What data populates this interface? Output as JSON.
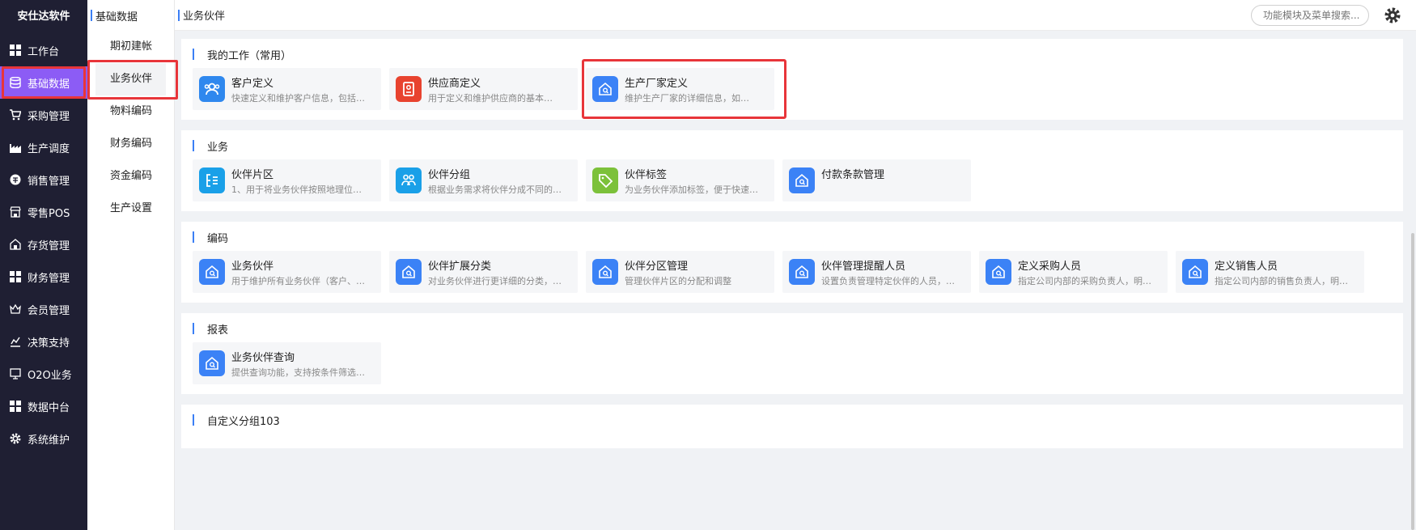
{
  "app": {
    "title": "安仕达软件"
  },
  "nav": {
    "items": [
      {
        "label": "工作台",
        "icon": "grid-icon"
      },
      {
        "label": "基础数据",
        "icon": "database-icon"
      },
      {
        "label": "采购管理",
        "icon": "cart-icon"
      },
      {
        "label": "生产调度",
        "icon": "factory-icon"
      },
      {
        "label": "销售管理",
        "icon": "sales-icon"
      },
      {
        "label": "零售POS",
        "icon": "store-icon"
      },
      {
        "label": "存货管理",
        "icon": "warehouse-icon"
      },
      {
        "label": "财务管理",
        "icon": "grid-icon"
      },
      {
        "label": "会员管理",
        "icon": "crown-icon"
      },
      {
        "label": "决策支持",
        "icon": "chart-icon"
      },
      {
        "label": "O2O业务",
        "icon": "monitor-icon"
      },
      {
        "label": "数据中台",
        "icon": "grid-icon"
      },
      {
        "label": "系统维护",
        "icon": "gear-icon"
      }
    ]
  },
  "subnav": {
    "title": "基础数据",
    "items": [
      "期初建帐",
      "业务伙伴",
      "物料编码",
      "财务编码",
      "资金编码",
      "生产设置"
    ]
  },
  "header": {
    "title": "业务伙伴",
    "search_placeholder": "功能模块及菜单搜索..."
  },
  "sections": [
    {
      "title": "我的工作（常用）",
      "cards": [
        {
          "name": "客户定义",
          "desc": "快速定义和维护客户信息，包括…",
          "icon": "customer-icon",
          "color": "#2f88ee"
        },
        {
          "name": "供应商定义",
          "desc": "用于定义和维护供应商的基本…",
          "icon": "supplier-icon",
          "color": "#e8432f"
        },
        {
          "name": "生产厂家定义",
          "desc": "维护生产厂家的详细信息，如…",
          "icon": "home-search-icon",
          "color": "#3b82f6"
        }
      ]
    },
    {
      "title": "业务",
      "cards": [
        {
          "name": "伙伴片区",
          "desc": "1、用于将业务伙伴按照地理位…",
          "icon": "region-icon",
          "color": "#1aa0e8"
        },
        {
          "name": "伙伴分组",
          "desc": "根据业务需求将伙伴分成不同的…",
          "icon": "group-icon",
          "color": "#1aa0e8"
        },
        {
          "name": "伙伴标签",
          "desc": "为业务伙伴添加标签，便于快速…",
          "icon": "tag-icon",
          "color": "#7cc13a"
        },
        {
          "name": "付款条款管理",
          "desc": "",
          "icon": "home-search-icon",
          "color": "#3b82f6"
        }
      ]
    },
    {
      "title": "编码",
      "cards": [
        {
          "name": "业务伙伴",
          "desc": "用于维护所有业务伙伴（客户、…",
          "icon": "home-search-icon",
          "color": "#3b82f6"
        },
        {
          "name": "伙伴扩展分类",
          "desc": "对业务伙伴进行更详细的分类，…",
          "icon": "home-search-icon",
          "color": "#3b82f6"
        },
        {
          "name": "伙伴分区管理",
          "desc": "管理伙伴片区的分配和调整",
          "icon": "home-search-icon",
          "color": "#3b82f6"
        },
        {
          "name": "伙伴管理提醒人员",
          "desc": "设置负责管理特定伙伴的人员，…",
          "icon": "home-search-icon",
          "color": "#3b82f6"
        },
        {
          "name": "定义采购人员",
          "desc": "指定公司内部的采购负责人，明…",
          "icon": "home-search-icon",
          "color": "#3b82f6"
        },
        {
          "name": "定义销售人员",
          "desc": "指定公司内部的销售负责人，明…",
          "icon": "home-search-icon",
          "color": "#3b82f6"
        }
      ]
    },
    {
      "title": "报表",
      "cards": [
        {
          "name": "业务伙伴查询",
          "desc": "提供查询功能，支持按条件筛选…",
          "icon": "home-search-icon",
          "color": "#3b82f6"
        }
      ]
    },
    {
      "title": "自定义分组103",
      "cards": []
    }
  ],
  "colors": {
    "nav_bg": "#1f1f33",
    "nav_active": "#8c5cf5",
    "accent": "#3b7ff5",
    "highlight": "#e8353a"
  }
}
